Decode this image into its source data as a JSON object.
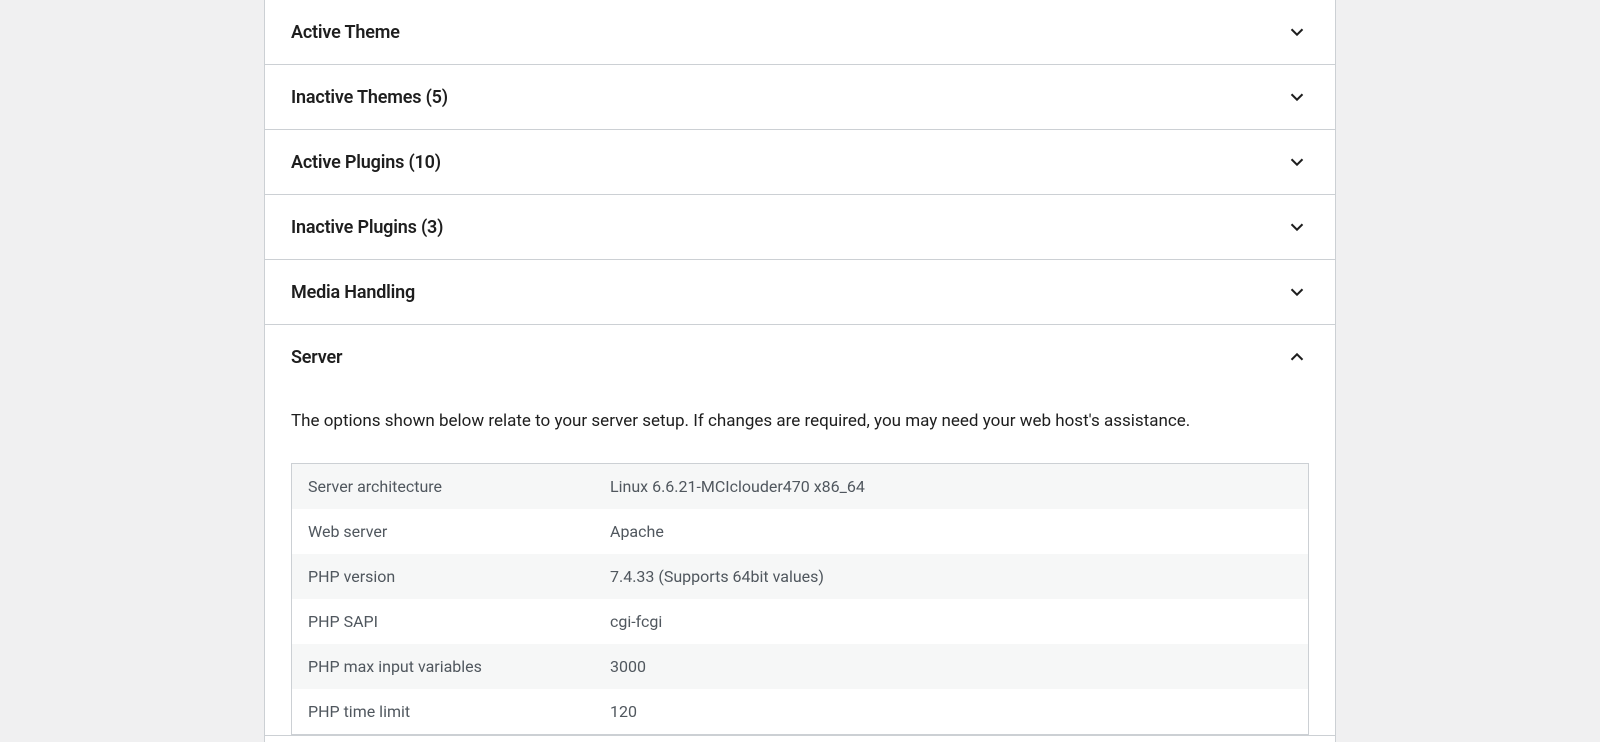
{
  "sections": {
    "active_theme": {
      "title": "Active Theme"
    },
    "inactive_themes": {
      "title": "Inactive Themes (5)"
    },
    "active_plugins": {
      "title": "Active Plugins (10)"
    },
    "inactive_plugins": {
      "title": "Inactive Plugins (3)"
    },
    "media_handling": {
      "title": "Media Handling"
    },
    "server": {
      "title": "Server",
      "description": "The options shown below relate to your server setup. If changes are required, you may need your web host's assistance.",
      "rows": [
        {
          "label": "Server architecture",
          "value": "Linux 6.6.21-MCIclouder470 x86_64"
        },
        {
          "label": "Web server",
          "value": "Apache"
        },
        {
          "label": "PHP version",
          "value": "7.4.33 (Supports 64bit values)"
        },
        {
          "label": "PHP SAPI",
          "value": "cgi-fcgi"
        },
        {
          "label": "PHP max input variables",
          "value": "3000"
        },
        {
          "label": "PHP time limit",
          "value": "120"
        }
      ]
    }
  }
}
